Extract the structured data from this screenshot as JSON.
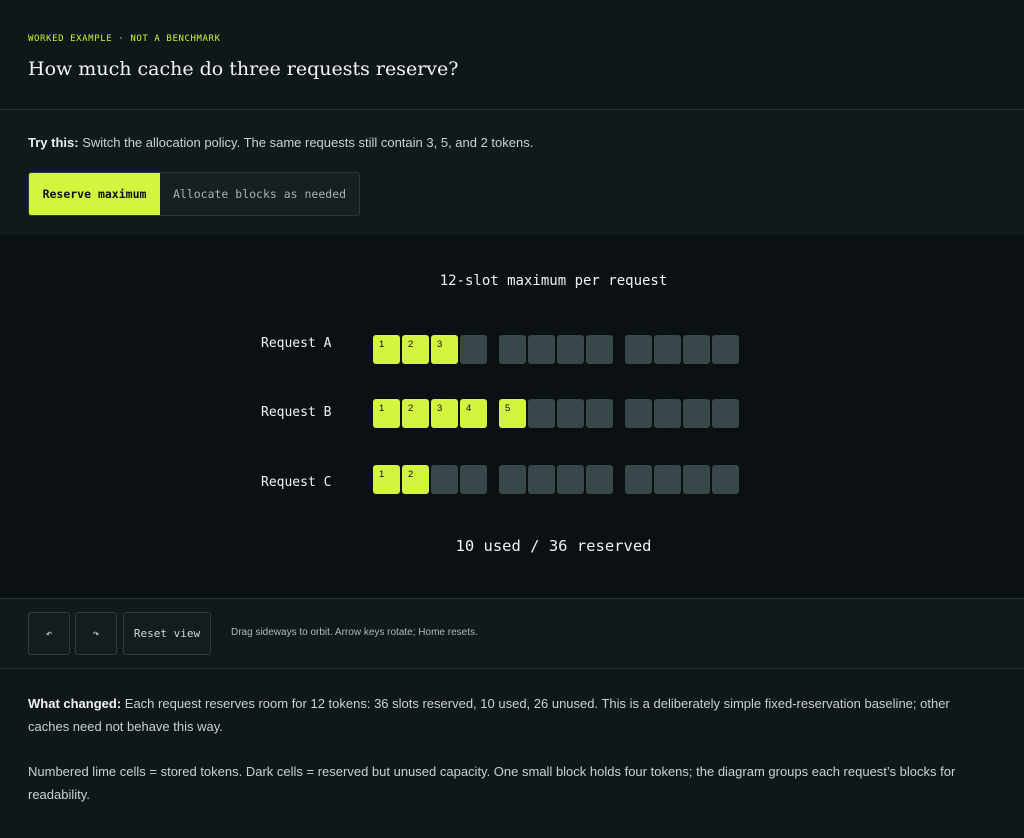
{
  "header": {
    "eyebrow": "WORKED EXAMPLE · NOT A BENCHMARK",
    "title": "How much cache do three requests reserve?"
  },
  "controls": {
    "try_label": "Try this:",
    "try_text": " Switch the allocation policy. The same requests still contain 3, 5, and 2 tokens.",
    "options": [
      "Reserve maximum",
      "Allocate blocks as needed"
    ],
    "selected": "Reserve maximum"
  },
  "diagram": {
    "title": "12-slot maximum per request",
    "rows": [
      {
        "label": "Request A",
        "used": 3,
        "reserved": 12,
        "tokens": [
          "1",
          "2",
          "3"
        ]
      },
      {
        "label": "Request B",
        "used": 5,
        "reserved": 12,
        "tokens": [
          "1",
          "2",
          "3",
          "4",
          "5"
        ]
      },
      {
        "label": "Request C",
        "used": 2,
        "reserved": 12,
        "tokens": [
          "1",
          "2"
        ]
      }
    ],
    "summary": "10 used / 36 reserved",
    "colors": {
      "used": "#d2f53d",
      "unused": "#37474a",
      "background": "#0b1112"
    }
  },
  "viewbar": {
    "rotate_left_icon": "↶",
    "rotate_right_icon": "↷",
    "reset_label": "Reset view",
    "hint": "Drag sideways to orbit. Arrow keys rotate; Home resets."
  },
  "explain": {
    "changed_label": "What changed:",
    "changed_text": " Each request reserves room for 12 tokens: 36 slots reserved, 10 used, 26 unused. This is a deliberately simple fixed-reservation baseline; other caches need not behave this way.",
    "legend_text": "Numbered lime cells = stored tokens. Dark cells = reserved but unused capacity. One small block holds four tokens; the diagram groups each request’s blocks for readability."
  }
}
